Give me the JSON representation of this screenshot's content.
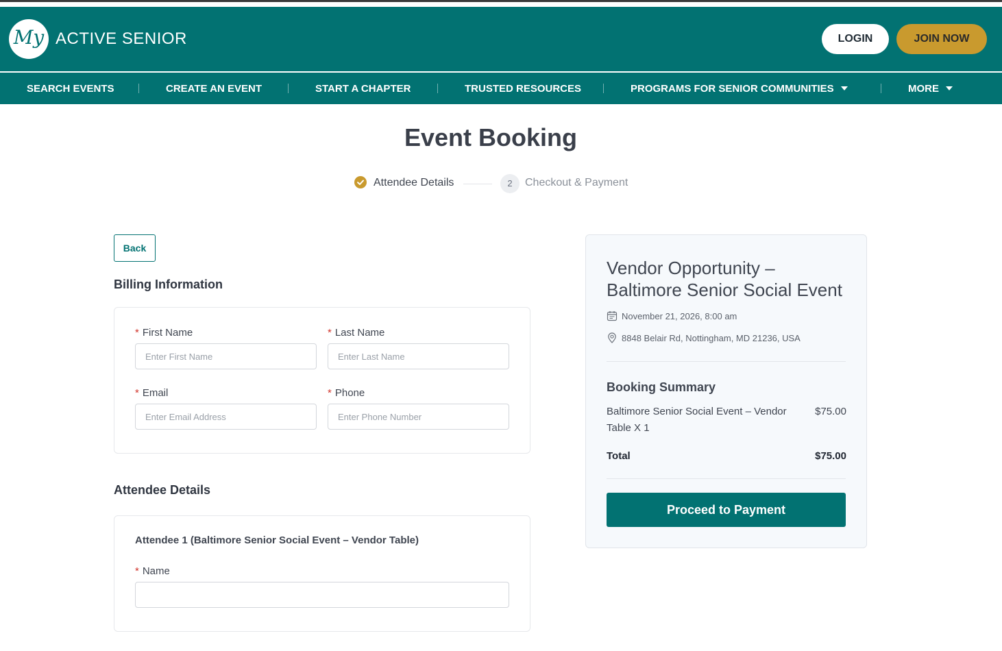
{
  "brand": {
    "logo_mark": "My",
    "name": "ACTIVE SENIOR"
  },
  "header": {
    "login_label": "LOGIN",
    "join_label": "JOIN NOW"
  },
  "nav": {
    "items": [
      {
        "label": "SEARCH EVENTS"
      },
      {
        "label": "CREATE AN EVENT"
      },
      {
        "label": "START A CHAPTER"
      },
      {
        "label": "TRUSTED RESOURCES"
      },
      {
        "label": "PROGRAMS FOR SENIOR COMMUNITIES",
        "dropdown": true
      },
      {
        "label": "MORE",
        "dropdown": true
      }
    ]
  },
  "page": {
    "title": "Event Booking"
  },
  "steps": {
    "step1": {
      "label": "Attendee Details",
      "icon": "check-circle-icon",
      "status": "complete"
    },
    "step2": {
      "number": "2",
      "label": "Checkout & Payment",
      "status": "pending"
    }
  },
  "back_label": "Back",
  "billing": {
    "heading": "Billing Information",
    "required_marker": "*",
    "first_name": {
      "label": "First Name",
      "placeholder": "Enter First Name",
      "value": ""
    },
    "last_name": {
      "label": "Last Name",
      "placeholder": "Enter Last Name",
      "value": ""
    },
    "email": {
      "label": "Email",
      "placeholder": "Enter Email Address",
      "value": ""
    },
    "phone": {
      "label": "Phone",
      "placeholder": "Enter Phone Number",
      "value": ""
    }
  },
  "attendees": {
    "heading": "Attendee Details",
    "attendee1": {
      "title": "Attendee 1 (Baltimore Senior Social Event – Vendor Table)",
      "name": {
        "label": "Name",
        "placeholder": "",
        "value": ""
      }
    }
  },
  "summary": {
    "event_title": "Vendor Opportunity – Baltimore Senior Social Event",
    "date": "November 21, 2026, 8:00 am",
    "location": "8848 Belair Rd, Nottingham, MD 21236, USA",
    "heading": "Booking Summary",
    "item_label": "Baltimore Senior Social Event – Vendor Table X 1",
    "item_price": "$75.00",
    "total_label": "Total",
    "total_value": "$75.00",
    "proceed_label": "Proceed to Payment"
  },
  "colors": {
    "brand_teal": "#027272",
    "accent_gold": "#c99a2e",
    "required_red": "#d1342b"
  }
}
